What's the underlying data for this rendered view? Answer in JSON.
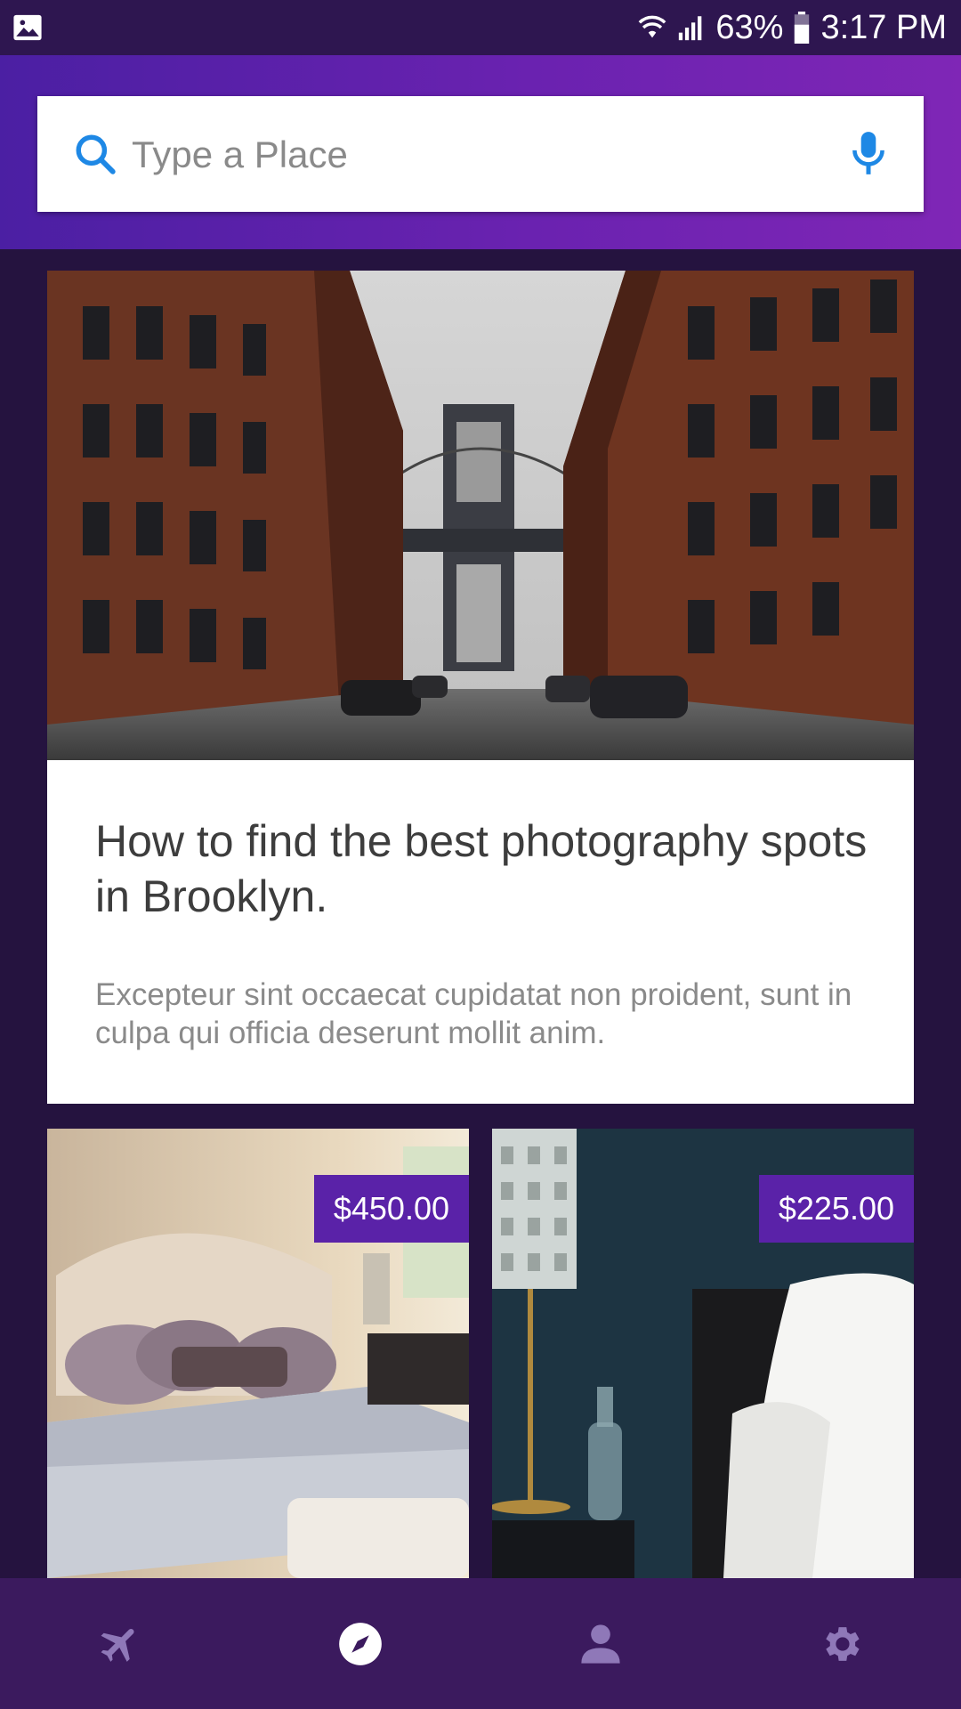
{
  "status_bar": {
    "battery": "63%",
    "time": "3:17 PM",
    "icons": [
      "gallery-icon",
      "wifi-icon",
      "signal-icon",
      "battery-icon"
    ]
  },
  "search": {
    "placeholder": "Type a Place",
    "value": "",
    "icons": [
      "search-icon",
      "mic-icon"
    ]
  },
  "article": {
    "title": "How to find the best photography spots in Brooklyn.",
    "excerpt": "Excepteur sint occaecat cupidatat non proident, sunt in culpa qui officia deserunt mollit anim."
  },
  "listings": [
    {
      "price": "$450.00"
    },
    {
      "price": "$225.00"
    }
  ],
  "bottom_nav": {
    "items": [
      {
        "icon": "airplane-icon",
        "active": false
      },
      {
        "icon": "compass-icon",
        "active": true
      },
      {
        "icon": "person-icon",
        "active": false
      },
      {
        "icon": "gear-icon",
        "active": false
      }
    ]
  },
  "colors": {
    "background": "#25133f",
    "status_bar": "#2e1650",
    "header_gradient_start": "#4b1fa3",
    "header_gradient_end": "#7f26b6",
    "accent_blue": "#1e88e5",
    "price_badge": "#5a22a8",
    "nav_background": "#3b1a5e",
    "nav_icon_inactive": "#8f78b8",
    "nav_icon_active": "#ffffff"
  }
}
